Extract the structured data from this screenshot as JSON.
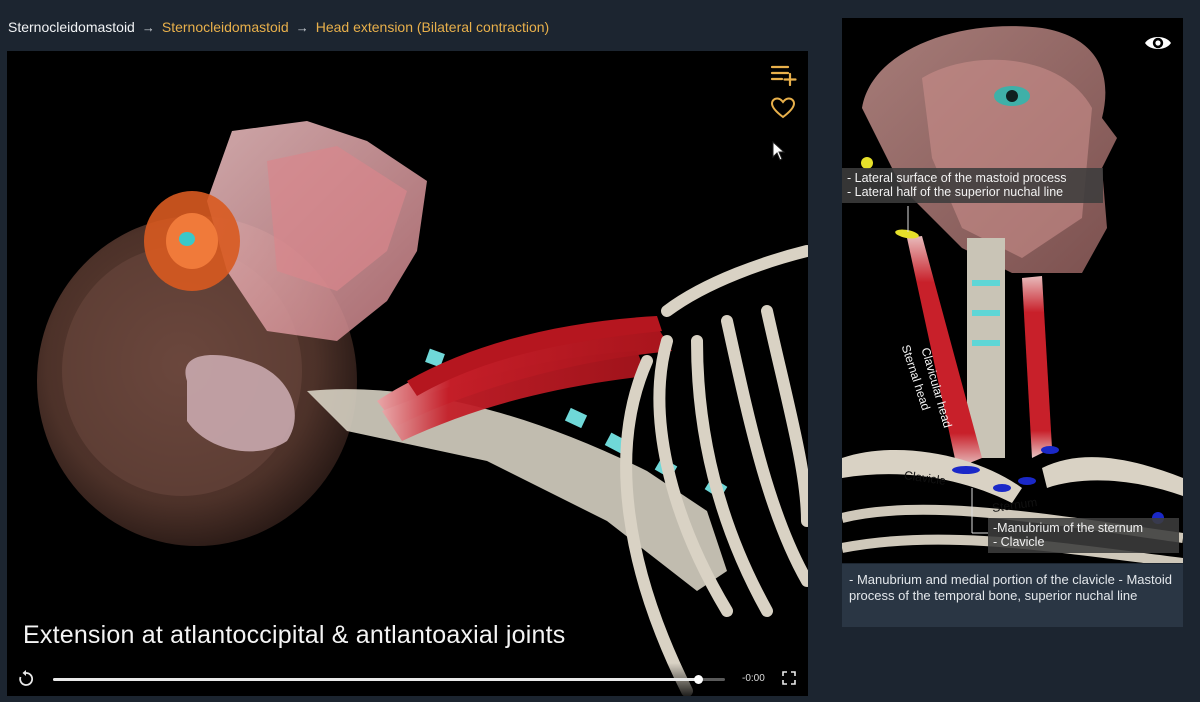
{
  "breadcrumb": {
    "root": "Sternocleidomastoid",
    "items": [
      "Sternocleidomastoid",
      "Head extension (Bilateral contraction)"
    ],
    "separator": "→"
  },
  "player": {
    "caption": "Extension at atlantoccipital & antlantoaxial joints",
    "time_remaining": "-0:00",
    "progress_fraction": 0.96,
    "icons": {
      "add_to_playlist": "playlist-add-icon",
      "favorite": "heart-icon",
      "replay": "replay-icon",
      "fullscreen": "fullscreen-icon"
    }
  },
  "side_panel": {
    "origin_label": [
      "- Lateral surface of the mastoid process",
      "- Lateral half of the superior nuchal line"
    ],
    "insertion_label": [
      "-Manubrium of the sternum",
      "- Clavicle"
    ],
    "muscle_tags": {
      "sternal_head": "Sternal head",
      "clavicular_head": "Clavicular head",
      "clavicle": "Clavicle",
      "sternum": "Sternum"
    },
    "description": "- Manubrium and medial portion of the clavicle - Mastoid process of the temporal bone, superior nuchal line",
    "icons": {
      "visibility": "eye-icon"
    }
  },
  "colors": {
    "accent": "#e8b04b",
    "background": "#1c2530",
    "panel": "#2a3644",
    "muscle_red": "#c8202a",
    "origin_marker": "#e6e02a",
    "insertion_marker": "#1a28c8"
  }
}
